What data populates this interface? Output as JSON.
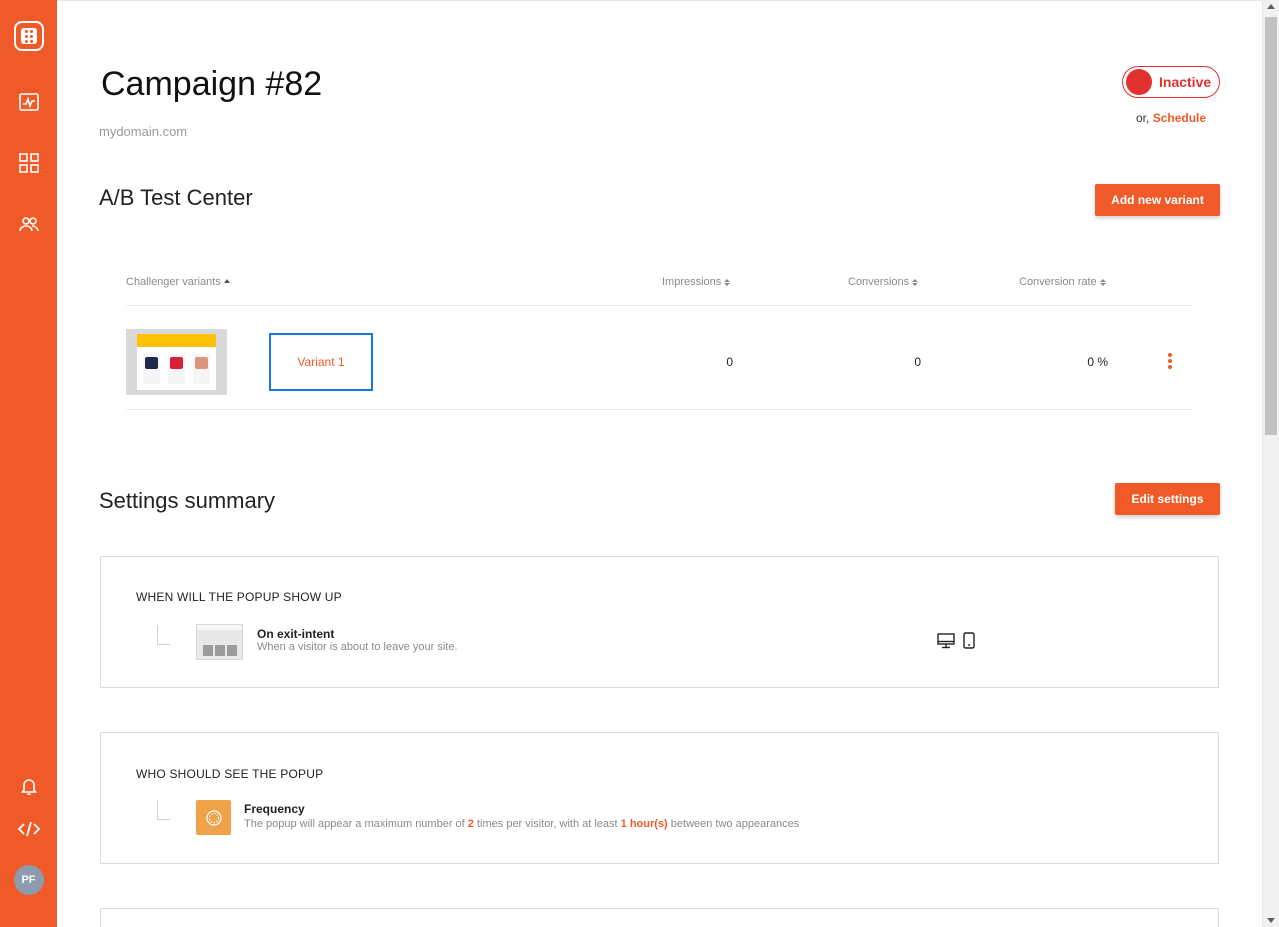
{
  "sidebar": {
    "logo": "app-logo",
    "items": [
      {
        "icon": "analytics-icon"
      },
      {
        "icon": "dashboard-grid-icon"
      },
      {
        "icon": "users-icon"
      }
    ],
    "bottom": [
      {
        "icon": "bell-icon"
      },
      {
        "icon": "code-icon"
      }
    ],
    "avatar_initials": "PF"
  },
  "campaign": {
    "title": "Campaign #82",
    "domain": "mydomain.com",
    "status_label": "Inactive",
    "schedule_prefix": "or,",
    "schedule_link": "Schedule"
  },
  "ab_test": {
    "title": "A/B Test Center",
    "add_button": "Add new variant",
    "columns": [
      "Challenger variants",
      "Impressions",
      "Conversions",
      "Conversion rate"
    ],
    "rows": [
      {
        "name": "Variant 1",
        "impressions": "0",
        "conversions": "0",
        "conversion_rate": "0 %"
      }
    ]
  },
  "settings": {
    "title": "Settings summary",
    "edit_button": "Edit settings",
    "cards": [
      {
        "heading": "WHEN WILL THE POPUP SHOW UP",
        "item_title": "On exit-intent",
        "item_desc": "When a visitor is about to leave your site.",
        "devices": [
          "desktop-icon",
          "mobile-icon"
        ]
      },
      {
        "heading": "WHO SHOULD SEE THE POPUP",
        "item_title": "Frequency",
        "desc_part1": "The popup will appear a maximum number of",
        "desc_value1": "2",
        "desc_part2": "times per visitor, with at least",
        "desc_value2": "1 hour(s)",
        "desc_part3": "between two appearances"
      }
    ]
  },
  "colors": {
    "accent": "#EF5A28",
    "inactive": "#E0312E",
    "selection": "#1479E0",
    "frequency_icon": "#EEA24A"
  }
}
